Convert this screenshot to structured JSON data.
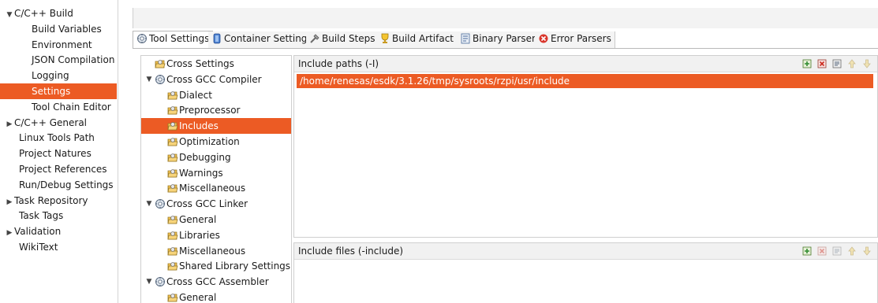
{
  "left_tree": {
    "items": [
      {
        "label": "C/C++ Build",
        "arrow": "▼",
        "indent": 0,
        "selected": false
      },
      {
        "label": "Build Variables",
        "arrow": "",
        "indent": 1,
        "selected": false
      },
      {
        "label": "Environment",
        "arrow": "",
        "indent": 1,
        "selected": false
      },
      {
        "label": "JSON Compilation D",
        "arrow": "",
        "indent": 1,
        "selected": false
      },
      {
        "label": "Logging",
        "arrow": "",
        "indent": 1,
        "selected": false
      },
      {
        "label": "Settings",
        "arrow": "",
        "indent": 1,
        "selected": true
      },
      {
        "label": "Tool Chain Editor",
        "arrow": "",
        "indent": 1,
        "selected": false
      },
      {
        "label": "C/C++ General",
        "arrow": "▶",
        "indent": 0,
        "selected": false
      },
      {
        "label": "Linux Tools Path",
        "arrow": "",
        "indent": 0,
        "selected": false
      },
      {
        "label": "Project Natures",
        "arrow": "",
        "indent": 0,
        "selected": false
      },
      {
        "label": "Project References",
        "arrow": "",
        "indent": 0,
        "selected": false
      },
      {
        "label": "Run/Debug Settings",
        "arrow": "",
        "indent": 0,
        "selected": false
      },
      {
        "label": "Task Repository",
        "arrow": "▶",
        "indent": 0,
        "selected": false
      },
      {
        "label": "Task Tags",
        "arrow": "",
        "indent": 0,
        "selected": false
      },
      {
        "label": "Validation",
        "arrow": "▶",
        "indent": 0,
        "selected": false
      },
      {
        "label": "WikiText",
        "arrow": "",
        "indent": 0,
        "selected": false
      }
    ]
  },
  "tabs": [
    {
      "label": "Tool Settings",
      "icon": "tool-settings-icon",
      "active": true
    },
    {
      "label": "Container Settings",
      "icon": "container-icon",
      "active": false
    },
    {
      "label": "Build Steps",
      "icon": "build-steps-icon",
      "active": false
    },
    {
      "label": "Build Artifact",
      "icon": "build-artifact-icon",
      "active": false
    },
    {
      "label": "Binary Parsers",
      "icon": "binary-parsers-icon",
      "active": false
    },
    {
      "label": "Error Parsers",
      "icon": "error-parsers-icon",
      "active": false
    }
  ],
  "tool_tree": {
    "items": [
      {
        "label": "Cross Settings",
        "kind": "option",
        "arrow": "",
        "level": 0,
        "selected": false
      },
      {
        "label": "Cross GCC Compiler",
        "kind": "tool",
        "arrow": "▼",
        "level": 0,
        "selected": false
      },
      {
        "label": "Dialect",
        "kind": "option",
        "arrow": "",
        "level": 1,
        "selected": false
      },
      {
        "label": "Preprocessor",
        "kind": "option",
        "arrow": "",
        "level": 1,
        "selected": false
      },
      {
        "label": "Includes",
        "kind": "option",
        "arrow": "",
        "level": 1,
        "selected": true
      },
      {
        "label": "Optimization",
        "kind": "option",
        "arrow": "",
        "level": 1,
        "selected": false
      },
      {
        "label": "Debugging",
        "kind": "option",
        "arrow": "",
        "level": 1,
        "selected": false
      },
      {
        "label": "Warnings",
        "kind": "option",
        "arrow": "",
        "level": 1,
        "selected": false
      },
      {
        "label": "Miscellaneous",
        "kind": "option",
        "arrow": "",
        "level": 1,
        "selected": false
      },
      {
        "label": "Cross GCC Linker",
        "kind": "tool",
        "arrow": "▼",
        "level": 0,
        "selected": false
      },
      {
        "label": "General",
        "kind": "option",
        "arrow": "",
        "level": 1,
        "selected": false
      },
      {
        "label": "Libraries",
        "kind": "option",
        "arrow": "",
        "level": 1,
        "selected": false
      },
      {
        "label": "Miscellaneous",
        "kind": "option",
        "arrow": "",
        "level": 1,
        "selected": false
      },
      {
        "label": "Shared Library Settings",
        "kind": "option",
        "arrow": "",
        "level": 1,
        "selected": false
      },
      {
        "label": "Cross GCC Assembler",
        "kind": "tool",
        "arrow": "▼",
        "level": 0,
        "selected": false
      },
      {
        "label": "General",
        "kind": "option",
        "arrow": "",
        "level": 1,
        "selected": false
      }
    ]
  },
  "include_paths": {
    "title": "Include paths (-I)",
    "entries": [
      "/home/renesas/esdk/3.1.26/tmp/sysroots/rzpi/usr/include"
    ],
    "tools": [
      {
        "icon": "add-icon",
        "enabled": true
      },
      {
        "icon": "delete-icon",
        "enabled": true
      },
      {
        "icon": "edit-icon",
        "enabled": true
      },
      {
        "icon": "move-up-icon",
        "enabled": false
      },
      {
        "icon": "move-down-icon",
        "enabled": false
      }
    ]
  },
  "include_files": {
    "title": "Include files (-include)",
    "entries": [],
    "tools": [
      {
        "icon": "add-icon",
        "enabled": true
      },
      {
        "icon": "delete-icon",
        "enabled": false
      },
      {
        "icon": "edit-icon",
        "enabled": false
      },
      {
        "icon": "move-up-icon",
        "enabled": false
      },
      {
        "icon": "move-down-icon",
        "enabled": false
      }
    ]
  },
  "colors": {
    "selection": "#ec5b24"
  }
}
